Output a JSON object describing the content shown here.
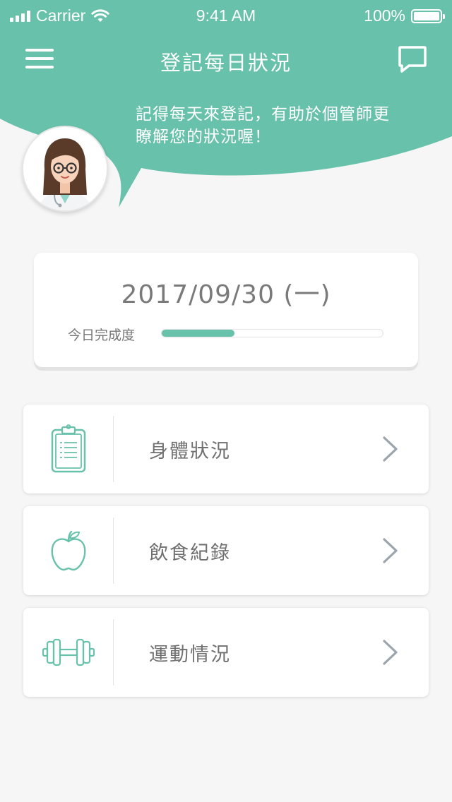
{
  "status_bar": {
    "carrier": "Carrier",
    "time": "9:41 AM",
    "battery": "100%"
  },
  "header": {
    "title": "登記每日狀況",
    "menu_icon": "hamburger-menu-icon",
    "chat_icon": "chat-bubble-icon",
    "speech_line1": "記得每天來登記，有助於個管師更",
    "speech_line2": "瞭解您的狀況喔！",
    "avatar": "nurse-avatar",
    "bg_color": "#68c1aa"
  },
  "date_card": {
    "date": "2017/09/30 (一)",
    "progress_label": "今日完成度",
    "progress": 0.33,
    "progress_color": "#68c1aa"
  },
  "menu_items": [
    {
      "label": "身體狀況",
      "icon": "clipboard-icon"
    },
    {
      "label": "飲食紀錄",
      "icon": "apple-icon"
    },
    {
      "label": "運動情況",
      "icon": "dumbbell-icon"
    }
  ],
  "colors": {
    "accent": "#68c1aa",
    "background": "#f6f6f6",
    "chevron": "#9aa5ad"
  }
}
